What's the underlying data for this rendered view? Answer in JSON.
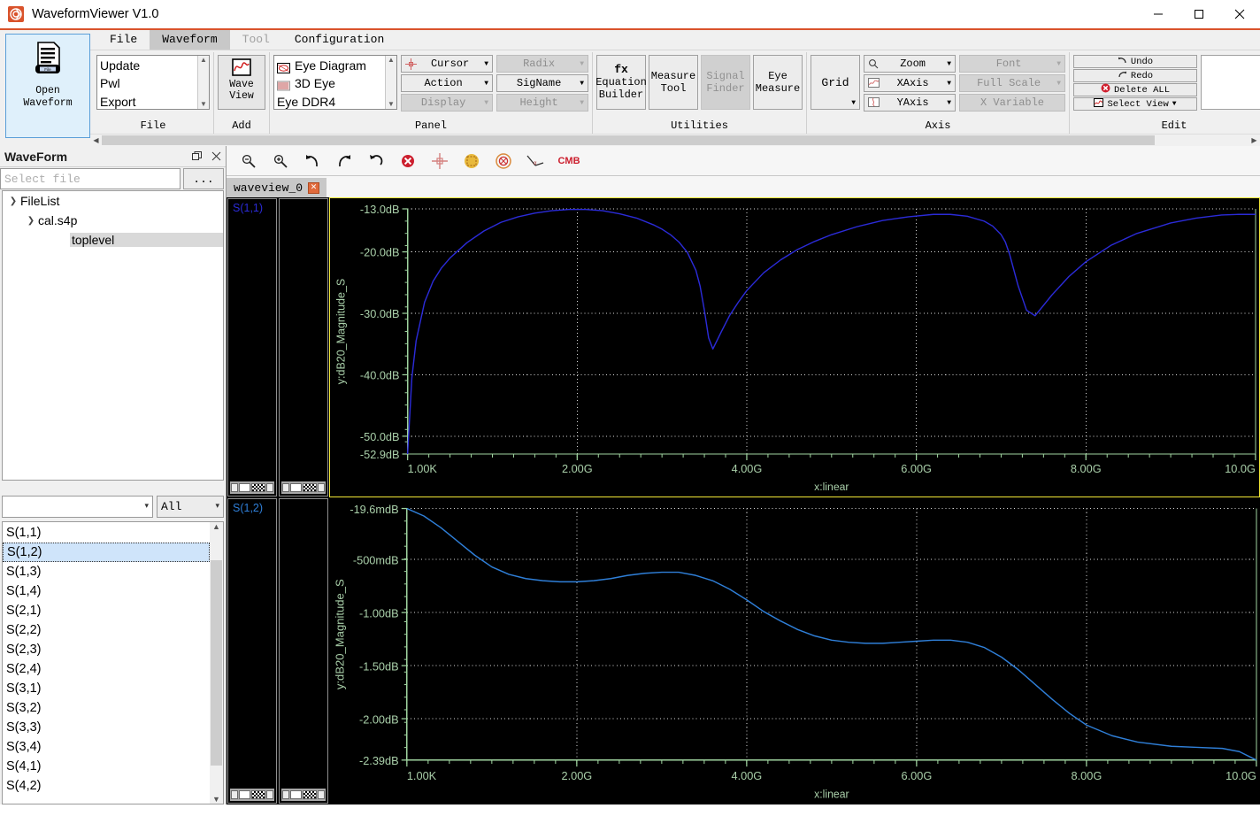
{
  "window": {
    "title": "WaveformViewer V1.0",
    "app_icon": "waveform-app-icon",
    "minimize": "—",
    "maximize": "□",
    "close": "✕"
  },
  "ribbon": {
    "big_button": {
      "line1": "Open",
      "line2": "Waveform",
      "icon_label": "File"
    },
    "tabs": [
      {
        "label": "File",
        "active": false,
        "disabled": false
      },
      {
        "label": "Waveform",
        "active": true,
        "disabled": false
      },
      {
        "label": "Tool",
        "active": false,
        "disabled": true
      },
      {
        "label": "Configuration",
        "active": false,
        "disabled": false
      }
    ],
    "groups": [
      {
        "name": "File",
        "list_items": [
          "Update",
          "Pwl",
          "Export"
        ]
      },
      {
        "name": "Add",
        "button": {
          "line1": "Wave",
          "line2": "View",
          "icon": "waveform-icon"
        }
      },
      {
        "name": "Panel",
        "list_items": [
          {
            "label": "Eye Diagram",
            "icon": "eye-diagram-icon"
          },
          {
            "label": "3D Eye",
            "icon": "3d-eye-icon"
          },
          {
            "label": "Eye DDR4",
            "icon": "eye-ddr4-icon"
          }
        ],
        "dropdowns_left": [
          {
            "label": "Cursor",
            "icon": "cursor-crosshair-icon",
            "disabled": false
          },
          {
            "label": "Action",
            "icon": "",
            "disabled": false
          },
          {
            "label": "Display",
            "icon": "",
            "disabled": true
          }
        ],
        "dropdowns_right": [
          {
            "label": "Radix",
            "disabled": true
          },
          {
            "label": "SigName",
            "disabled": false
          },
          {
            "label": "Height",
            "disabled": true
          }
        ]
      },
      {
        "name": "Utilities",
        "buttons": [
          {
            "line1": "fx",
            "line2": "Equation",
            "line3": "Builder",
            "disabled": false
          },
          {
            "line1": "Measure",
            "line2": "Tool",
            "disabled": false
          },
          {
            "line1": "Signal",
            "line2": "Finder",
            "disabled": true
          },
          {
            "line1": "Eye",
            "line2": "Measure",
            "disabled": false
          }
        ]
      },
      {
        "name": "Axis",
        "grid_button": "Grid",
        "dropdowns_left": [
          {
            "label": "Zoom",
            "icon": "magnifier-icon",
            "disabled": false
          },
          {
            "label": "XAxis",
            "icon": "xaxis-icon",
            "disabled": false
          },
          {
            "label": "YAxis",
            "icon": "yaxis-icon",
            "disabled": false
          }
        ],
        "dropdowns_right": [
          {
            "label": "Font",
            "disabled": true
          },
          {
            "label": "Full Scale",
            "disabled": true
          },
          {
            "label": "X Variable",
            "disabled": true
          }
        ]
      },
      {
        "name": "Edit",
        "buttons": [
          {
            "label": "Undo",
            "icon": "undo-icon",
            "caret": false
          },
          {
            "label": "Redo",
            "icon": "redo-icon",
            "caret": false
          },
          {
            "label": "Delete ALL",
            "icon": "delete-icon",
            "caret": false
          },
          {
            "label": "Select View",
            "icon": "select-view-icon",
            "caret": true
          }
        ]
      }
    ]
  },
  "left_dock": {
    "title": "WaveForm",
    "float_button": "❐",
    "close_button": "✕",
    "file_input": {
      "value": "",
      "placeholder": "Select file"
    },
    "browse_button": "...",
    "tree": [
      {
        "label": "FileList",
        "indent": 0,
        "expanded": true,
        "selected": false
      },
      {
        "label": "cal.s4p",
        "indent": 1,
        "expanded": true,
        "selected": false
      },
      {
        "label": "toplevel",
        "indent": 2,
        "expanded": null,
        "selected": true
      }
    ],
    "filter_combo": {
      "value": ""
    },
    "type_combo": {
      "value": "All"
    },
    "signal_list": [
      {
        "label": "S(1,1)",
        "selected": false
      },
      {
        "label": "S(1,2)",
        "selected": true
      },
      {
        "label": "S(1,3)",
        "selected": false
      },
      {
        "label": "S(1,4)",
        "selected": false
      },
      {
        "label": "S(2,1)",
        "selected": false
      },
      {
        "label": "S(2,2)",
        "selected": false
      },
      {
        "label": "S(2,3)",
        "selected": false
      },
      {
        "label": "S(2,4)",
        "selected": false
      },
      {
        "label": "S(3,1)",
        "selected": false
      },
      {
        "label": "S(3,2)",
        "selected": false
      },
      {
        "label": "S(3,3)",
        "selected": false
      },
      {
        "label": "S(3,4)",
        "selected": false
      },
      {
        "label": "S(4,1)",
        "selected": false
      },
      {
        "label": "S(4,2)",
        "selected": false
      }
    ]
  },
  "plot_dock": {
    "toolbar_icons": [
      "zoom-out-icon",
      "zoom-in-icon",
      "undo-arrow-icon",
      "redo-arrow-icon",
      "reset-arrow-icon",
      "delete-circle-icon",
      "crosshair-cursor-icon",
      "marker-dot-icon",
      "measure-circle-icon",
      "angle-measure-icon",
      "cmb-icon"
    ],
    "cmb_label": "CMB",
    "tab": {
      "label": "waveview_0",
      "close": "✕"
    }
  },
  "chart_data": [
    {
      "type": "line",
      "signal_label": "S(1,1)",
      "title": "",
      "xlabel": "x:linear",
      "ylabel": "y:dB20_Magnitude_S",
      "line_color": "#2b2bd8",
      "axis_color": "#9fd39f",
      "bg_color": "#000000",
      "grid": true,
      "focused": true,
      "xlim": [
        0.001,
        10.0
      ],
      "ylim": [
        -52.9,
        -13.0
      ],
      "xtick_labels": [
        "1.00K",
        "2.00G",
        "4.00G",
        "6.00G",
        "8.00G",
        "10.0G"
      ],
      "xtick_values": [
        1e-06,
        2.0,
        4.0,
        6.0,
        8.0,
        10.0
      ],
      "ytick_labels": [
        "-13.0dB",
        "-20.0dB",
        "-30.0dB",
        "-40.0dB",
        "-50.0dB",
        "-52.9dB"
      ],
      "ytick_values": [
        -13.0,
        -20.0,
        -30.0,
        -40.0,
        -50.0,
        -52.9
      ],
      "x": [
        0.0,
        0.05,
        0.1,
        0.2,
        0.3,
        0.4,
        0.5,
        0.7,
        0.9,
        1.1,
        1.3,
        1.5,
        1.7,
        1.9,
        2.1,
        2.3,
        2.5,
        2.7,
        2.9,
        3.0,
        3.1,
        3.2,
        3.3,
        3.4,
        3.45,
        3.5,
        3.55,
        3.6,
        3.7,
        3.8,
        3.9,
        4.0,
        4.2,
        4.4,
        4.6,
        4.8,
        5.0,
        5.3,
        5.6,
        5.9,
        6.2,
        6.4,
        6.6,
        6.8,
        6.9,
        7.0,
        7.05,
        7.1,
        7.2,
        7.3,
        7.4,
        7.6,
        7.8,
        8.0,
        8.3,
        8.6,
        9.0,
        9.3,
        9.6,
        9.8,
        10.0
      ],
      "y": [
        -52.9,
        -40.5,
        -34.5,
        -28.2,
        -24.8,
        -22.6,
        -21.0,
        -18.5,
        -16.6,
        -15.2,
        -14.3,
        -13.7,
        -13.3,
        -13.1,
        -13.1,
        -13.3,
        -13.8,
        -14.5,
        -15.6,
        -16.3,
        -17.2,
        -18.4,
        -20.1,
        -23.0,
        -25.6,
        -29.5,
        -34.0,
        -35.8,
        -33.0,
        -30.3,
        -28.2,
        -26.3,
        -23.4,
        -21.3,
        -19.6,
        -18.3,
        -17.2,
        -15.9,
        -14.9,
        -14.3,
        -13.9,
        -13.9,
        -14.2,
        -15.0,
        -15.8,
        -17.2,
        -18.4,
        -20.4,
        -25.5,
        -29.5,
        -30.4,
        -27.0,
        -24.0,
        -21.6,
        -18.9,
        -17.0,
        -15.3,
        -14.5,
        -14.0,
        -13.9,
        -13.9
      ]
    },
    {
      "type": "line",
      "signal_label": "S(1,2)",
      "title": "",
      "xlabel": "x:linear",
      "ylabel": "y:dB20_Magnitude_S",
      "line_color": "#2f7fd8",
      "axis_color": "#9fd39f",
      "bg_color": "#000000",
      "grid": true,
      "focused": false,
      "xlim": [
        0.001,
        10.0
      ],
      "ylim": [
        -2.39,
        -0.0196
      ],
      "xtick_labels": [
        "1.00K",
        "2.00G",
        "4.00G",
        "6.00G",
        "8.00G",
        "10.0G"
      ],
      "xtick_values": [
        1e-06,
        2.0,
        4.0,
        6.0,
        8.0,
        10.0
      ],
      "ytick_labels": [
        "-19.6mdB",
        "-500mdB",
        "-1.00dB",
        "-1.50dB",
        "-2.00dB",
        "-2.39dB"
      ],
      "ytick_values": [
        -0.0196,
        -0.5,
        -1.0,
        -1.5,
        -2.0,
        -2.39
      ],
      "x": [
        0.0,
        0.2,
        0.4,
        0.6,
        0.8,
        1.0,
        1.2,
        1.4,
        1.6,
        1.8,
        2.0,
        2.2,
        2.4,
        2.6,
        2.8,
        3.0,
        3.2,
        3.4,
        3.6,
        3.8,
        4.0,
        4.2,
        4.4,
        4.6,
        4.8,
        5.0,
        5.2,
        5.4,
        5.6,
        5.8,
        6.0,
        6.2,
        6.4,
        6.6,
        6.8,
        7.0,
        7.2,
        7.4,
        7.6,
        7.8,
        8.0,
        8.3,
        8.6,
        9.0,
        9.3,
        9.6,
        9.8,
        10.0
      ],
      "y": [
        -0.0196,
        -0.09,
        -0.2,
        -0.33,
        -0.46,
        -0.57,
        -0.64,
        -0.68,
        -0.7,
        -0.71,
        -0.71,
        -0.7,
        -0.68,
        -0.65,
        -0.63,
        -0.62,
        -0.62,
        -0.65,
        -0.7,
        -0.78,
        -0.88,
        -0.99,
        -1.08,
        -1.16,
        -1.22,
        -1.26,
        -1.28,
        -1.29,
        -1.29,
        -1.28,
        -1.27,
        -1.26,
        -1.26,
        -1.28,
        -1.33,
        -1.42,
        -1.54,
        -1.68,
        -1.82,
        -1.95,
        -2.06,
        -2.16,
        -2.22,
        -2.26,
        -2.27,
        -2.28,
        -2.31,
        -2.39
      ]
    }
  ]
}
